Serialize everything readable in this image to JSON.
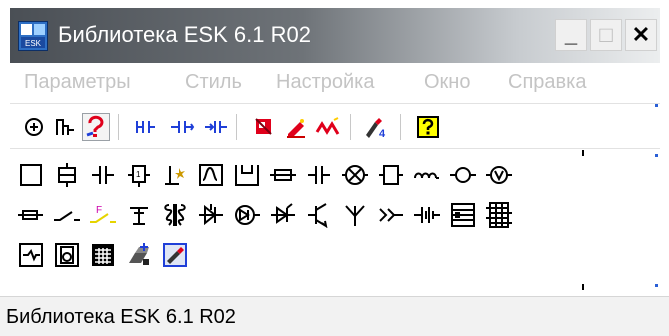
{
  "window": {
    "title": "Библиотека ESK 6.1 R02",
    "minimize_glyph": "_",
    "maximize_glyph": "□",
    "close_glyph": "✕"
  },
  "menu": {
    "items": [
      {
        "label": "Параметры"
      },
      {
        "label": "Стиль"
      },
      {
        "label": "Настройка"
      },
      {
        "label": "Окно"
      },
      {
        "label": "Справка"
      }
    ],
    "disabled": true
  },
  "toolbar": {
    "buttons": [
      {
        "icon": "target-icon"
      },
      {
        "icon": "connector-icon"
      },
      {
        "icon": "help-pointer-icon"
      },
      {
        "icon": "contact-split-icon"
      },
      {
        "icon": "contact-join-icon"
      },
      {
        "icon": "contact-arrow-icon"
      },
      {
        "icon": "red-block-icon"
      },
      {
        "icon": "red-pencil-icon"
      },
      {
        "icon": "red-wave-icon"
      },
      {
        "icon": "renumber-icon"
      },
      {
        "icon": "yellow-help-icon"
      }
    ],
    "accent_blue": "#1f3fd8",
    "accent_red": "#e0001b",
    "accent_yellow": "#ffff00"
  },
  "palette": {
    "row1": [
      "square-symbol-icon",
      "relay-coil-icon",
      "capacitor-icon",
      "fuse-1-icon",
      "ground-star-icon",
      "sine-box-icon",
      "cup-box-icon",
      "resistor-icon",
      "capacitor-bar-icon",
      "lamp-icon",
      "bracket-box-icon",
      "inductor-icon",
      "loop-icon",
      "voltmeter-icon"
    ],
    "row2": [
      "resistor-small-icon",
      "switch-icon",
      "flag-switch-icon",
      "antenna-ground-icon",
      "transformer-icon",
      "diode-bar-icon",
      "diode-circle-icon",
      "thyristor-icon",
      "transistor-icon",
      "antenna-icon",
      "plug-icon",
      "battery-icon",
      "bus-block-icon",
      "terminal-strip-icon"
    ],
    "row3": [
      "panel-icon",
      "speaker-icon",
      "table-grid-icon",
      "stamp-icon",
      "picker-icon"
    ]
  },
  "status": {
    "text": "Библиотека ESK 6.1 R02"
  }
}
